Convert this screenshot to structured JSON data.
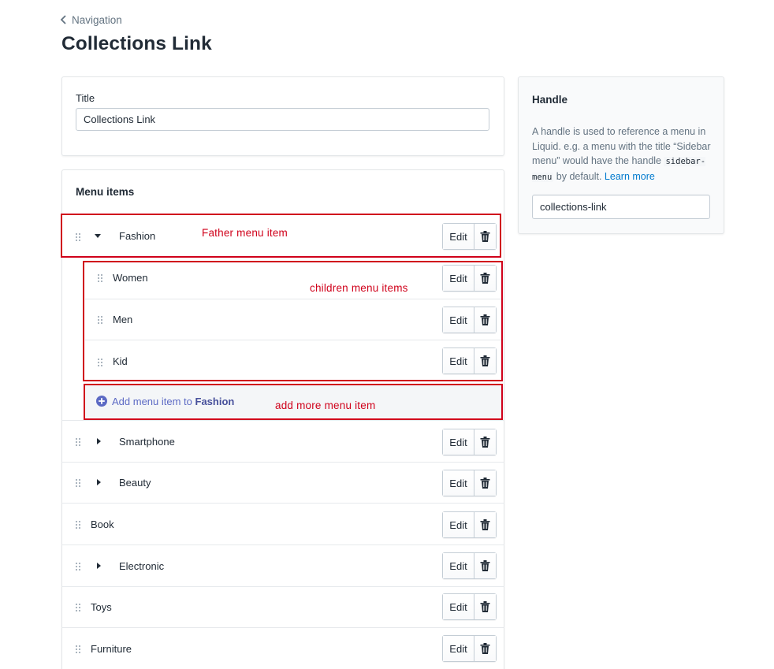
{
  "breadcrumb": {
    "label": "Navigation"
  },
  "page": {
    "title": "Collections Link"
  },
  "title_card": {
    "label": "Title",
    "value": "Collections Link"
  },
  "menu_card": {
    "heading": "Menu items",
    "edit_label": "Edit",
    "items": [
      {
        "label": "Fashion",
        "has_children": true,
        "expanded": true
      },
      {
        "label": "Women",
        "child": true
      },
      {
        "label": "Men",
        "child": true
      },
      {
        "label": "Kid",
        "child": true
      },
      {
        "label": "Smartphone",
        "has_children": true,
        "expanded": false
      },
      {
        "label": "Beauty",
        "has_children": true,
        "expanded": false
      },
      {
        "label": "Book",
        "has_children": false
      },
      {
        "label": "Electronic",
        "has_children": true,
        "expanded": false
      },
      {
        "label": "Toys",
        "has_children": false
      },
      {
        "label": "Furniture",
        "has_children": false
      }
    ],
    "add_item": {
      "prefix": "Add menu item to",
      "parent": "Fashion"
    }
  },
  "handle_card": {
    "title": "Handle",
    "description_before": "A handle is used to reference a menu in Liquid. e.g. a menu with the title “Sidebar menu” would have the handle ",
    "code": "sidebar-menu",
    "description_after": " by default. ",
    "link": "Learn more",
    "value": "collections-link"
  },
  "annotations": {
    "father": "Father menu item",
    "children": "children menu items",
    "add_more": "add more menu item",
    "color": "#d0021b"
  },
  "colors": {
    "link": "#5c6ac4",
    "text": "#212b36",
    "muted": "#637381"
  }
}
